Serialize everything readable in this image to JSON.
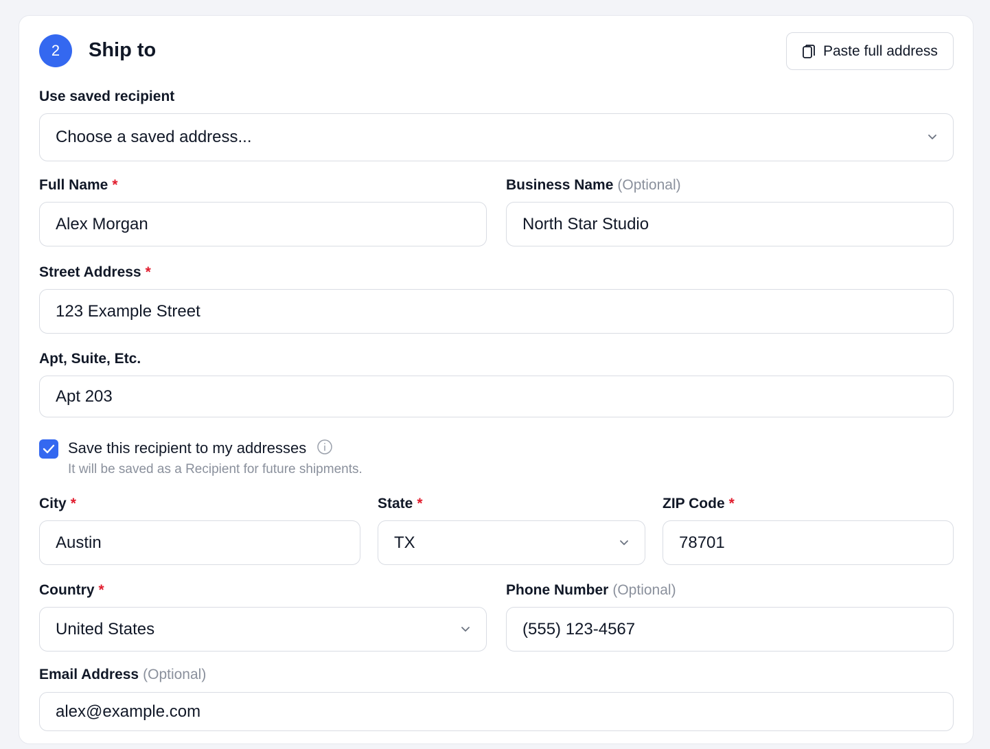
{
  "section": {
    "step_number": "2",
    "title": "Ship to",
    "paste_button": "Paste full address"
  },
  "saved_recipient": {
    "label": "Use saved recipient",
    "value": "Choose a saved address..."
  },
  "full_name": {
    "label": "Full Name",
    "required": "*",
    "value": "Alex Morgan"
  },
  "business_name": {
    "label": "Business Name",
    "optional": "(Optional)",
    "value": "North Star Studio"
  },
  "street_address": {
    "label": "Street Address",
    "required": "*",
    "value": "123 Example Street"
  },
  "apt_suite": {
    "label": "Apt, Suite, Etc.",
    "value": "Apt 203"
  },
  "save_recipient": {
    "checked": true,
    "label": "Save this recipient to my addresses",
    "helper": "It will be saved as a Recipient for future shipments."
  },
  "city": {
    "label": "City",
    "required": "*",
    "value": "Austin"
  },
  "state": {
    "label": "State",
    "required": "*",
    "value": "TX"
  },
  "zip_code": {
    "label": "ZIP Code",
    "required": "*",
    "value": "78701"
  },
  "country": {
    "label": "Country",
    "required": "*",
    "value": "United States"
  },
  "phone_number": {
    "label": "Phone Number",
    "optional": "(Optional)",
    "value": "(555) 123-4567"
  },
  "email_address": {
    "label": "Email Address",
    "optional": "(Optional)",
    "value": "alex@example.com"
  },
  "colors": {
    "accent": "#3468f0",
    "required": "#e11d2e",
    "muted": "#8a909c",
    "border": "#d9dce3"
  },
  "icons": {
    "paste": "clipboard-icon",
    "dropdown": "chevron-down-icon",
    "info": "info-icon",
    "check": "checkmark-icon"
  }
}
